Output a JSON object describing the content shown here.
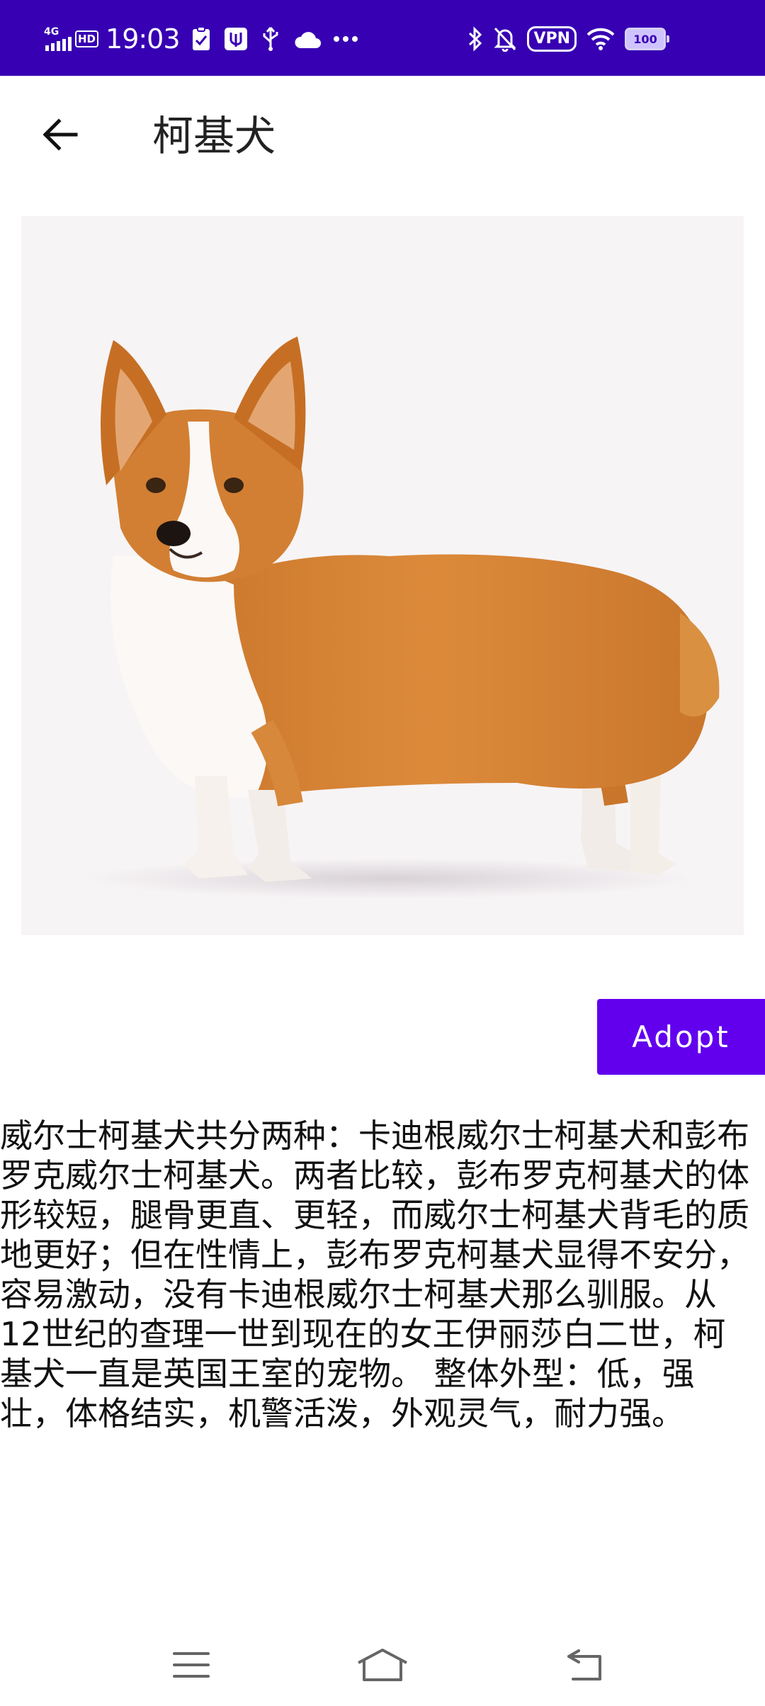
{
  "status_bar": {
    "network": "4G",
    "hd": "HD",
    "time": "19:03",
    "vpn": "VPN",
    "battery": "100"
  },
  "app_bar": {
    "title": "柯基犬"
  },
  "adopt_button": {
    "label": "Adopt"
  },
  "description": "威尔士柯基犬共分两种：卡迪根威尔士柯基犬和彭布罗克威尔士柯基犬。两者比较，彭布罗克柯基犬的体形较短，腿骨更直、更轻，而威尔士柯基犬背毛的质地更好；但在性情上，彭布罗克柯基犬显得不安分，容易激动，没有卡迪根威尔士柯基犬那么驯服。从12世纪的查理一世到现在的女王伊丽莎白二世，柯基犬一直是英国王室的宠物。 整体外型：低，强壮，体格结实，机警活泼，外观灵气，耐力强。",
  "colors": {
    "status_bar": "#3700B3",
    "primary": "#6200EE",
    "background": "#FFFFFF",
    "text": "#111111"
  },
  "icons": {
    "back": "arrow-left-icon",
    "nav_menu": "menu-icon",
    "nav_home": "home-icon",
    "nav_back": "return-icon"
  }
}
